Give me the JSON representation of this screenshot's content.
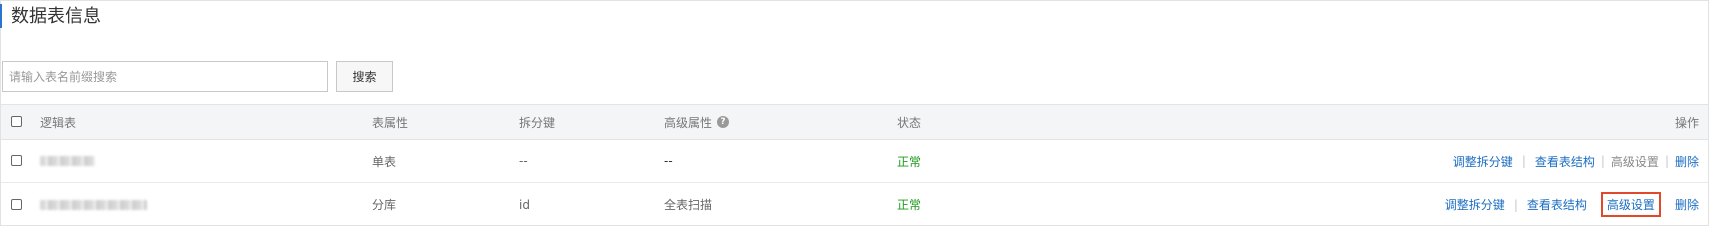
{
  "section": {
    "title": "数据表信息"
  },
  "search": {
    "placeholder": "请输入表名前缀搜索",
    "button_label": "搜索"
  },
  "table": {
    "headers": {
      "name": "逻辑表",
      "attr": "表属性",
      "key": "拆分键",
      "advanced": "高级属性",
      "status": "状态",
      "ops": "操作"
    },
    "rows": [
      {
        "attr": "单表",
        "key": "--",
        "advanced": "--",
        "status": "正常",
        "ops": {
          "adjust_key": "调整拆分键",
          "view_structure": "查看表结构",
          "advanced_settings": "高级设置",
          "delete": "删除"
        }
      },
      {
        "attr": "分库",
        "key": "id",
        "advanced": "全表扫描",
        "status": "正常",
        "ops": {
          "adjust_key": "调整拆分键",
          "view_structure": "查看表结构",
          "advanced_settings": "高级设置",
          "delete": "删除"
        }
      }
    ]
  },
  "colors": {
    "link": "#1c6ec2",
    "status_ok": "#1d9a1d",
    "highlight_border": "#e0492c",
    "title_accent": "#2a74cc"
  },
  "icons": {
    "help": "question-circle-icon"
  }
}
